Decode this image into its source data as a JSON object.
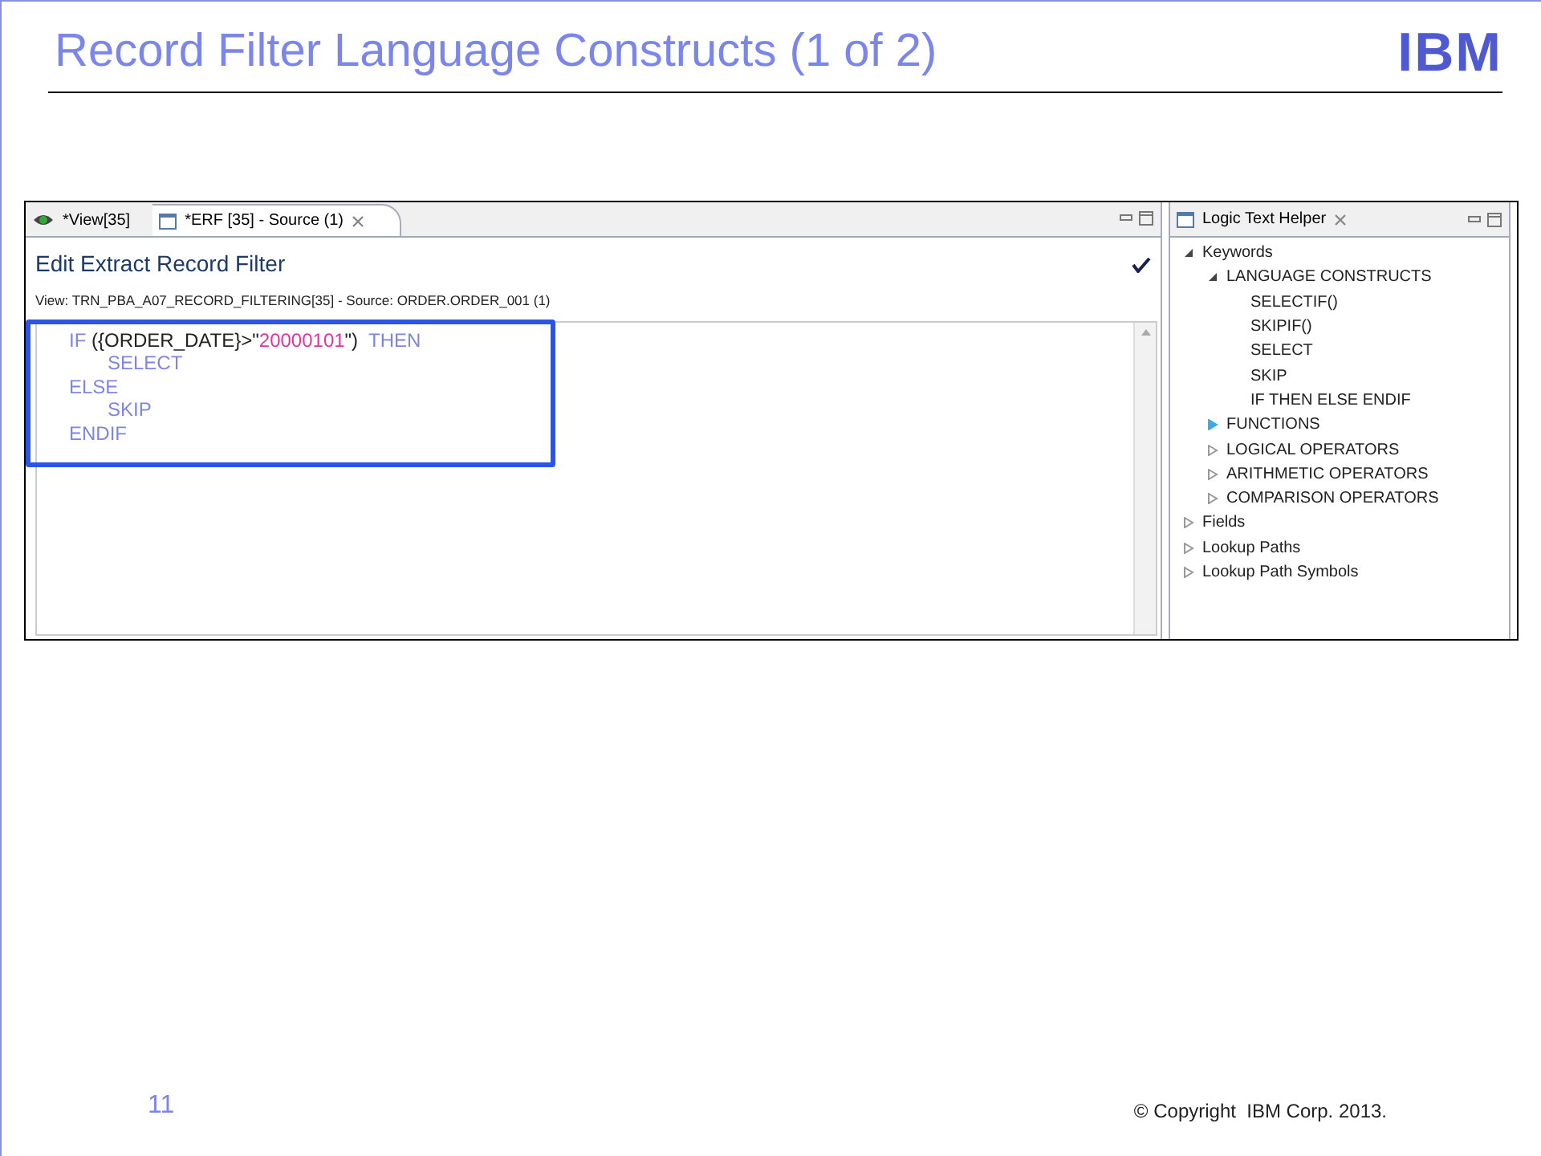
{
  "slide": {
    "title": "Record Filter Language Constructs (1 of 2)",
    "logo": "IBM",
    "page_number": "11",
    "copyright": "© Copyright  IBM Corp. 2013."
  },
  "editor": {
    "tabs": [
      {
        "label": "*View[35]",
        "selected": false
      },
      {
        "label": "*ERF [35] - Source (1)",
        "selected": true
      }
    ],
    "heading": "Edit Extract Record Filter",
    "subtitle": "View: TRN_PBA_A07_RECORD_FILTERING[35] - Source: ORDER.ORDER_001 (1)",
    "code_lines": [
      {
        "tokens": [
          {
            "kind": "keyword",
            "text": "IF "
          },
          {
            "kind": "plain",
            "text": "({ORDER_DATE}>\""
          },
          {
            "kind": "string",
            "text": "20000101"
          },
          {
            "kind": "plain",
            "text": "\")  "
          },
          {
            "kind": "keyword",
            "text": "THEN"
          }
        ],
        "children": [
          {
            "tokens": [
              {
                "kind": "keyword",
                "text": "SELECT"
              }
            ]
          }
        ]
      },
      {
        "tokens": [
          {
            "kind": "keyword",
            "text": "ELSE"
          }
        ],
        "children": [
          {
            "tokens": [
              {
                "kind": "keyword",
                "text": "SKIP"
              }
            ]
          }
        ]
      },
      {
        "tokens": [
          {
            "kind": "keyword",
            "text": "ENDIF"
          }
        ]
      }
    ]
  },
  "helper": {
    "title": "Logic Text Helper",
    "tree": [
      {
        "label": "Keywords",
        "expanded": true,
        "hovered": false,
        "children": [
          {
            "label": "LANGUAGE CONSTRUCTS",
            "expanded": true,
            "hovered": false,
            "children": [
              {
                "label": "SELECTIF()"
              },
              {
                "label": "SKIPIF()"
              },
              {
                "label": "SELECT"
              },
              {
                "label": "SKIP"
              },
              {
                "label": "IF THEN ELSE ENDIF"
              }
            ]
          },
          {
            "label": "FUNCTIONS",
            "expanded": false,
            "hovered": true
          },
          {
            "label": "LOGICAL OPERATORS",
            "expanded": false,
            "hovered": false
          },
          {
            "label": "ARITHMETIC OPERATORS",
            "expanded": false,
            "hovered": false
          },
          {
            "label": "COMPARISON OPERATORS",
            "expanded": false,
            "hovered": false
          }
        ]
      },
      {
        "label": "Fields",
        "expanded": false,
        "hovered": false
      },
      {
        "label": "Lookup Paths",
        "expanded": false,
        "hovered": false
      },
      {
        "label": "Lookup Path Symbols",
        "expanded": false,
        "hovered": false
      }
    ]
  }
}
